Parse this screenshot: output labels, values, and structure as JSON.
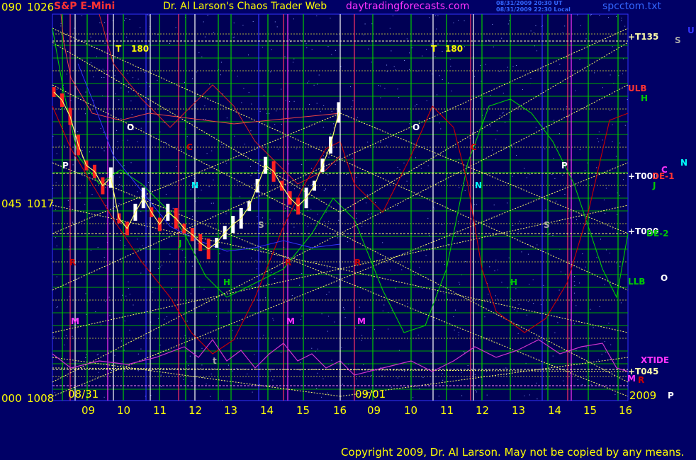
{
  "header": {
    "left_code": "090",
    "left_price": "1026",
    "symbol": "S&P E-Mini",
    "author": "Dr. Al Larson's Chaos Trader Web",
    "site": "daytradingforecasts.com",
    "stamp1": "08/31/2009 20:30 UT",
    "stamp2": "08/31/2009 22:30 Local",
    "file": "spcctom.txt"
  },
  "y_axis": [
    {
      "code": "090",
      "price": "1026"
    },
    {
      "code": "045",
      "price": "1017"
    },
    {
      "code": "000",
      "price": "1008"
    }
  ],
  "copyright": "Copyright 2009, Dr. Al Larson. May not be copied by any means.",
  "colors": {
    "background": "#000066",
    "grid_green": "#00cc00",
    "trend_yellow": "#ffff66",
    "price_up": "#ffffff",
    "price_down": "#ff2222",
    "magenta": "#ff33ff",
    "red_line": "#dd0000"
  },
  "chart_data": {
    "type": "line",
    "title": "S&P E-Mini",
    "x_ticks": [
      "09",
      "10",
      "11",
      "12",
      "13",
      "14",
      "15",
      "16",
      "09",
      "10",
      "11",
      "12",
      "13",
      "14",
      "15",
      "16"
    ],
    "date_labels": [
      "08/31",
      "09/01",
      "2009"
    ],
    "y_ticks": [
      "1026",
      "1017",
      "1008"
    ],
    "ylim": [
      1008,
      1026
    ],
    "series": [
      {
        "name": "S&P E-Mini",
        "values": [
          1022.8,
          1022.4,
          1021.6,
          1020.2,
          1019.2,
          1018.9,
          1018.2,
          1018.6,
          1016.6,
          1016.1,
          1016.9,
          1017.6,
          1016.9,
          1016.3,
          1016.9,
          1016.6,
          1016.1,
          1015.8,
          1015.4,
          1015.1,
          1015.4,
          1015.9,
          1016.3,
          1016.6,
          1017.2,
          1018.2,
          1019.2,
          1018.9,
          1018.2,
          1017.6,
          1017.2,
          1017.6,
          1018.2,
          1019.2,
          1020.2,
          1021.8
        ]
      }
    ],
    "right_labels": [
      "+T135",
      "ULB",
      "H",
      "+T000",
      "DE-1",
      "J",
      "N",
      "C",
      "+T090",
      "DE-2",
      "LLB",
      "O",
      "XTIDE",
      "+T045",
      "M",
      "R",
      "S",
      "U",
      "P"
    ],
    "chart_labels": [
      "T",
      "180",
      "O",
      "P",
      "N",
      "C",
      "J",
      "R",
      "H",
      "M",
      "S",
      "t",
      "T",
      "180",
      "O",
      "C",
      "N",
      "R",
      "H",
      "M",
      "S",
      "P",
      "R",
      "M"
    ]
  }
}
